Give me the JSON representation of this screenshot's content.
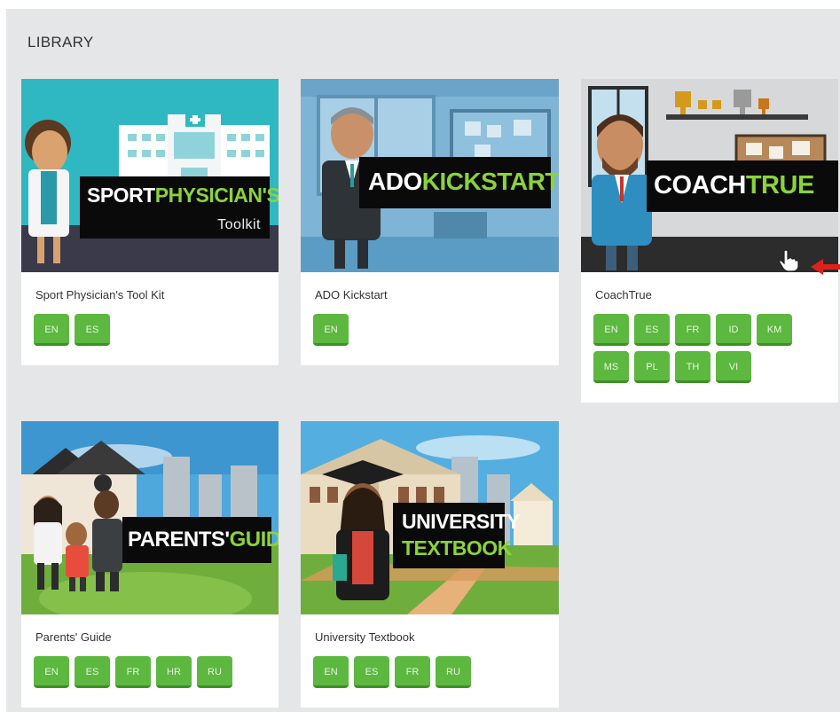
{
  "library": {
    "title": "LIBRARY"
  },
  "cards": [
    {
      "name": "Sport Physician's Tool Kit",
      "banner_white": "SPORT",
      "banner_green": "PHYSICIAN'S",
      "banner_sub": "Toolkit",
      "langs": [
        "EN",
        "ES"
      ]
    },
    {
      "name": "ADO Kickstart",
      "banner_white": "ADO",
      "banner_green": "KICKSTART",
      "langs": [
        "EN"
      ]
    },
    {
      "name": "CoachTrue",
      "banner_white": "COACH",
      "banner_green": "TRUE",
      "langs": [
        "EN",
        "ES",
        "FR",
        "ID",
        "KM",
        "MS",
        "PL",
        "TH",
        "VI"
      ]
    },
    {
      "name": "Parents' Guide",
      "banner_white": "PARENTS'",
      "banner_green": "GUIDE",
      "langs": [
        "EN",
        "ES",
        "FR",
        "HR",
        "RU"
      ]
    },
    {
      "name": "University Textbook",
      "banner_white": "UNIVERSITY",
      "banner_green": "TEXTBOOK",
      "langs": [
        "EN",
        "ES",
        "FR",
        "RU"
      ]
    }
  ],
  "colors": {
    "lang_button": "#5cb83f",
    "accent_green": "#8bd33a",
    "panel_bg": "#e5e6e7",
    "pointer_arrow": "#e0201c"
  },
  "icons": {
    "cursor": "hand-pointer-icon",
    "annotation": "red-arrow-icon"
  }
}
